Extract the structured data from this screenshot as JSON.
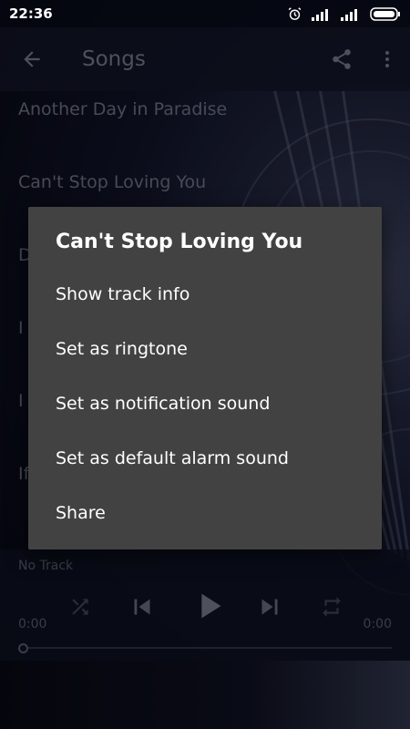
{
  "status_bar": {
    "time": "22:36",
    "icons": [
      "alarm-icon",
      "signal-icon",
      "signal-icon",
      "battery-icon"
    ]
  },
  "app_bar": {
    "title": "Songs",
    "back_icon": "arrow-left-icon",
    "share_icon": "share-icon",
    "more_icon": "more-vert-icon"
  },
  "songs": {
    "items": [
      {
        "title": "Another Day in Paradise"
      },
      {
        "title": "Can't Stop Loving You"
      },
      {
        "title": "D"
      },
      {
        "title": "I"
      },
      {
        "title": "I"
      },
      {
        "title": "If"
      }
    ]
  },
  "player": {
    "track": "No Track",
    "time_current": "0:00",
    "time_total": "0:00",
    "progress": 0
  },
  "dialog": {
    "title": "Can't Stop Loving You",
    "items": [
      {
        "label": "Show track info"
      },
      {
        "label": "Set as ringtone"
      },
      {
        "label": "Set as notification sound"
      },
      {
        "label": "Set as default alarm sound"
      },
      {
        "label": "Share"
      }
    ]
  },
  "colors": {
    "dialog_bg": "#424242",
    "app_bar_bg": "#161a30",
    "muted_text": "#84889b"
  }
}
